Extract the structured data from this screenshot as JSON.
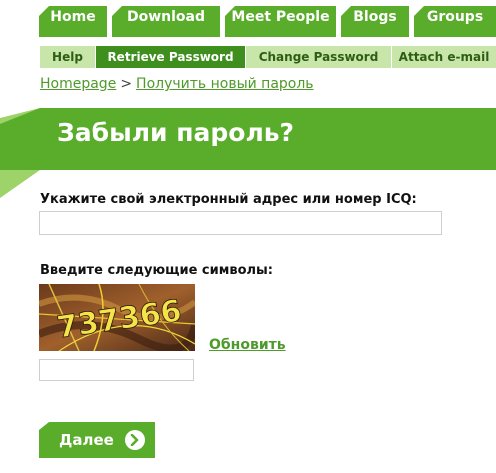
{
  "nav": {
    "main_tabs": [
      "Home",
      "Download",
      "Meet People",
      "Blogs",
      "Groups"
    ],
    "sub_tabs": [
      "Help",
      "Retrieve Password",
      "Change Password",
      "Attach e-mail"
    ]
  },
  "breadcrumb": {
    "home": "Homepage",
    "separator": ">",
    "current": "Получить новый пароль"
  },
  "page": {
    "title": "Забыли пароль?"
  },
  "form": {
    "email_label": "Укажите свой электронный адрес или номер ICQ:",
    "email_value": "",
    "captcha_label": "Введите следующие символы:",
    "captcha_text": "737366",
    "captcha_input_value": "",
    "refresh_label": "Обновить",
    "next_label": "Далее"
  },
  "colors": {
    "accent": "#5aad2b",
    "accent_dark": "#3f8f1f",
    "subnav_bg": "#c8e6a9",
    "link": "#4e9a2a"
  },
  "icons": {
    "next": "arrow-circle-right-icon"
  }
}
